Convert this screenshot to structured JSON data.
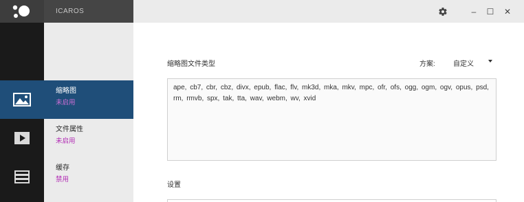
{
  "app": {
    "name": "ICAROS"
  },
  "window": {
    "minimize": "–",
    "maximize": "☐",
    "close": "✕"
  },
  "sidebar": {
    "items": [
      {
        "title": "缩略图",
        "status": "未启用",
        "icon": "image-icon",
        "active": true
      },
      {
        "title": "文件属性",
        "status": "未启用",
        "icon": "play-icon",
        "active": false
      },
      {
        "title": "缓存",
        "status": "禁用",
        "icon": "stack-icon",
        "active": false
      }
    ]
  },
  "main": {
    "thumbnail_types_label": "缩略图文件类型",
    "scheme_label": "方案:",
    "scheme_value": "自定义",
    "file_types": "ape, cb7, cbr, cbz, divx, epub, flac, flv, mk3d, mka, mkv, mpc, ofr, ofs, ogg, ogm, ogv, opus, psd, rm, rmvb, spx, tak, tta, wav, webm, wv, xvid",
    "settings_label": "设置"
  },
  "colors": {
    "accent": "#1f4e79",
    "status": "#b12ab4",
    "rail": "#1a1a1a",
    "panel": "#ebebeb"
  }
}
